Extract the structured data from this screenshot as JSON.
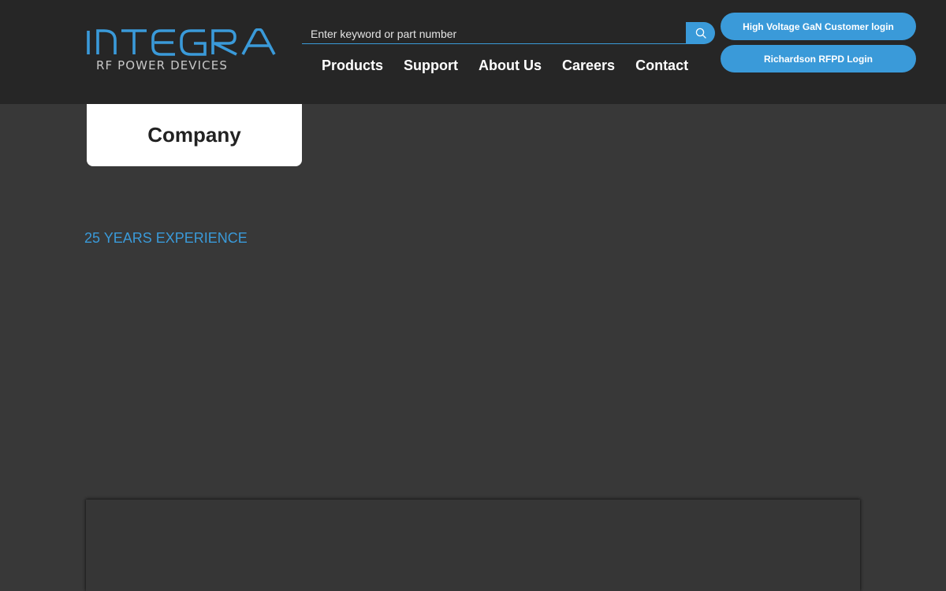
{
  "brand": {
    "name": "INTEGRA",
    "tagline": "RF POWER DEVICES",
    "accent_color": "#3a9ad9"
  },
  "search": {
    "placeholder": "Enter keyword or part number",
    "value": "",
    "icon": "search-icon"
  },
  "nav": {
    "items": [
      {
        "label": "Products"
      },
      {
        "label": "Support"
      },
      {
        "label": "About Us"
      },
      {
        "label": "Careers"
      },
      {
        "label": "Contact"
      }
    ]
  },
  "logins": {
    "gan_label": "High Voltage GaN Customer login",
    "richardson_label": "Richardson RFPD Login"
  },
  "page": {
    "section_title": "Company",
    "experience_text": "25 YEARS EXPERIENCE"
  },
  "colors": {
    "header_bg": "#262626",
    "page_bg": "#383838",
    "accent": "#3a9ad9",
    "card_bg": "#ffffff"
  }
}
